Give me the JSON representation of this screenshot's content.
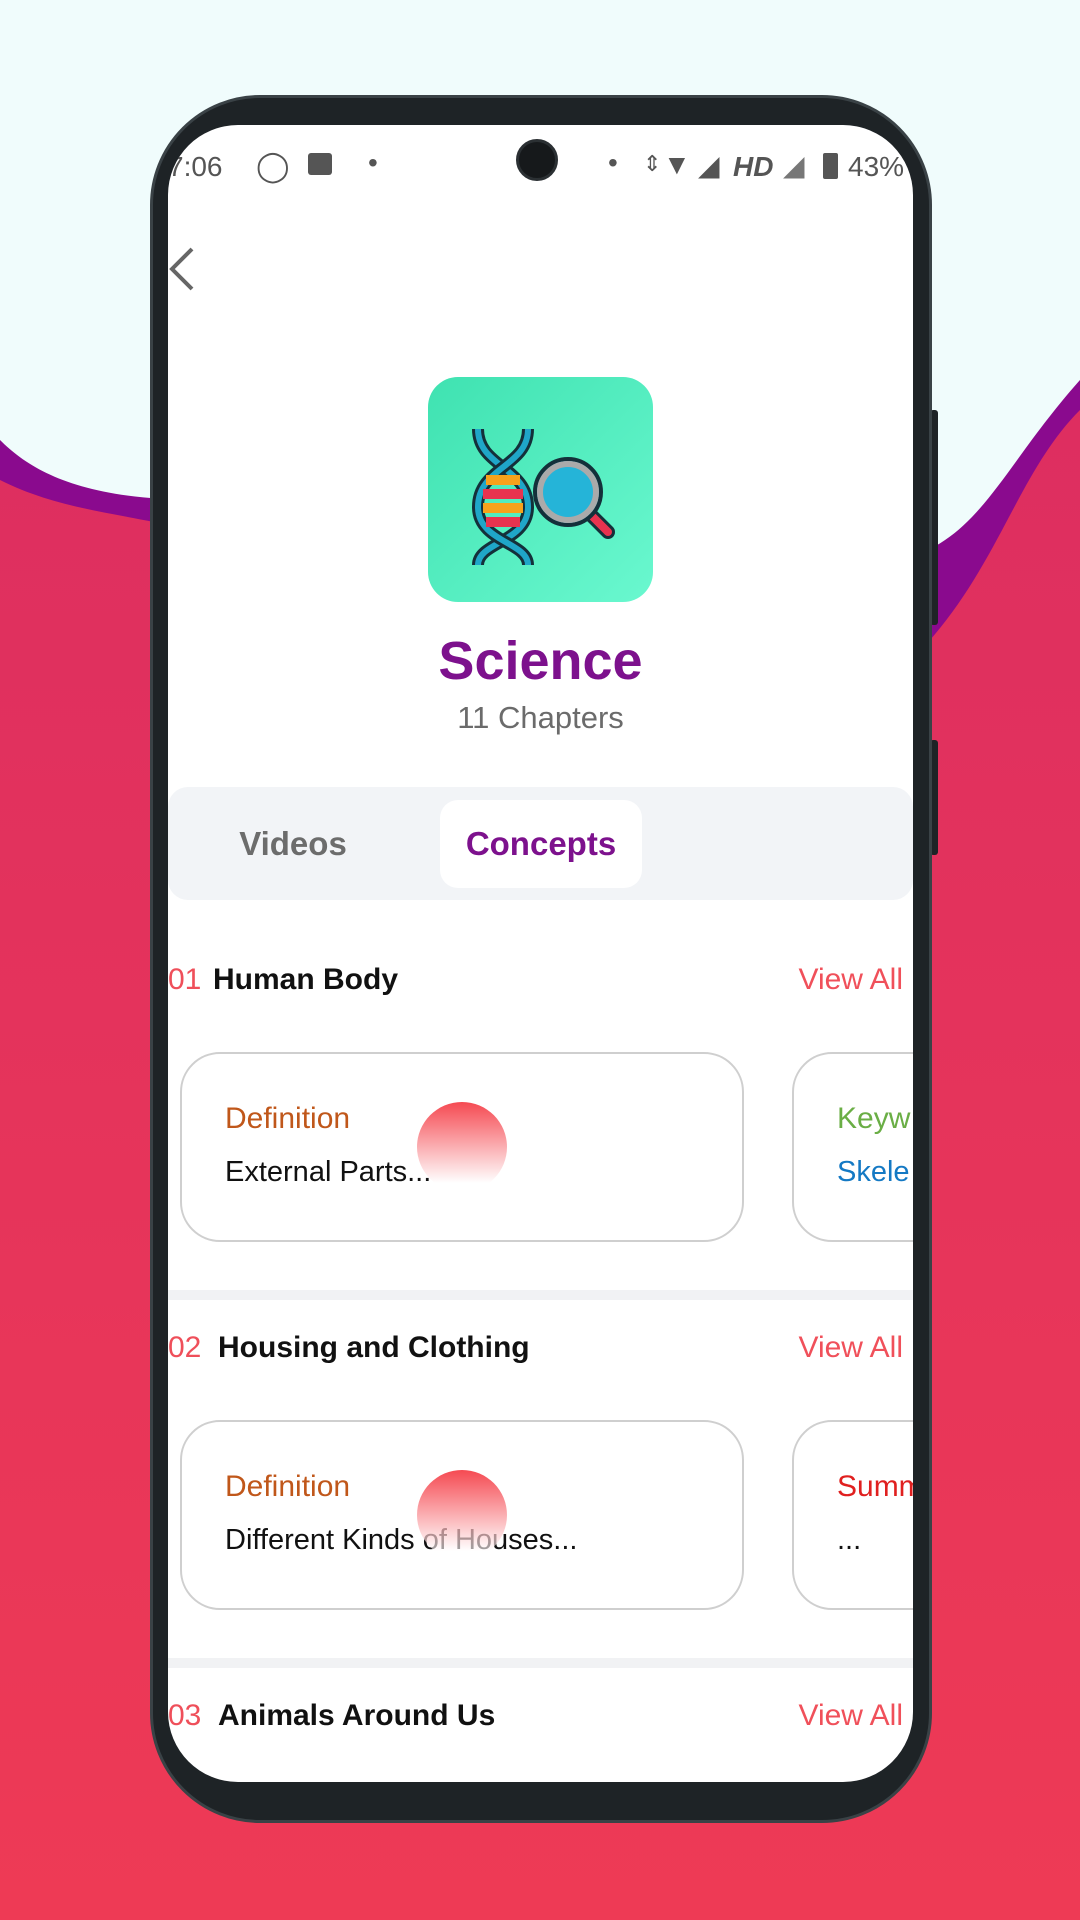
{
  "status_bar": {
    "time": "7:06",
    "battery": "43%",
    "network": "HD",
    "icons": [
      "whatsapp-icon",
      "message-icon",
      "dot-icon",
      "data-arrows-icon",
      "wifi-icon",
      "signal-icon",
      "signal-off-icon",
      "battery-icon"
    ]
  },
  "header": {
    "back_icon": "chevron-left-icon",
    "subject_icon": "dna-magnifier-icon",
    "title": "Science",
    "subtitle": "11 Chapters"
  },
  "tabs": [
    {
      "label": "Videos",
      "active": false
    },
    {
      "label": "Concepts",
      "active": true
    }
  ],
  "sections": [
    {
      "number": "01",
      "title": "Human Body",
      "view_all": "View All",
      "cards": [
        {
          "type": "Definition",
          "text": "External Parts...",
          "locked": true
        },
        {
          "type": "Keyw",
          "text": "Skele"
        }
      ]
    },
    {
      "number": "02",
      "title": "Housing and Clothing",
      "view_all": "View All",
      "cards": [
        {
          "type": "Definition",
          "text": "Different Kinds of Houses...",
          "locked": true
        },
        {
          "type": "Summ",
          "text": "..."
        }
      ]
    },
    {
      "number": "03",
      "title": "Animals Around Us",
      "view_all": "View All"
    }
  ],
  "colors": {
    "accent": "#7d118d",
    "red": "#f0505a",
    "definition": "#c0571a",
    "keyword": "#6aae45",
    "keyword_text": "#1479c4",
    "summary": "#e0201f",
    "tile": "#3fe2b1"
  }
}
